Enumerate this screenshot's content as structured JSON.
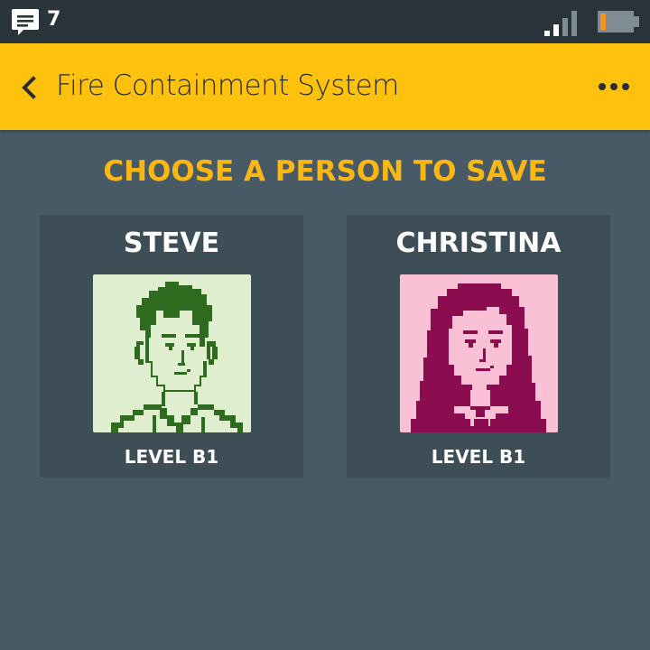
{
  "status_bar": {
    "message_count": "7",
    "icons": [
      "message-icon",
      "signal-icon",
      "battery-icon"
    ],
    "battery_color": "#f7931e"
  },
  "app_bar": {
    "title": "Fire Containment System",
    "back_icon": "chevron-left-icon",
    "menu_icon": "more-horizontal-icon",
    "color": "#fdc10e"
  },
  "main": {
    "heading": "CHOOSE A PERSON TO SAVE",
    "heading_color": "#fbb714",
    "people": [
      {
        "name": "STEVE",
        "level": "LEVEL B1",
        "portrait_bg": "#e0efd0",
        "portrait_fg": "#2f6b1f"
      },
      {
        "name": "CHRISTINA",
        "level": "LEVEL B1",
        "portrait_bg": "#f9c0d6",
        "portrait_fg": "#8b0c4f"
      }
    ]
  }
}
